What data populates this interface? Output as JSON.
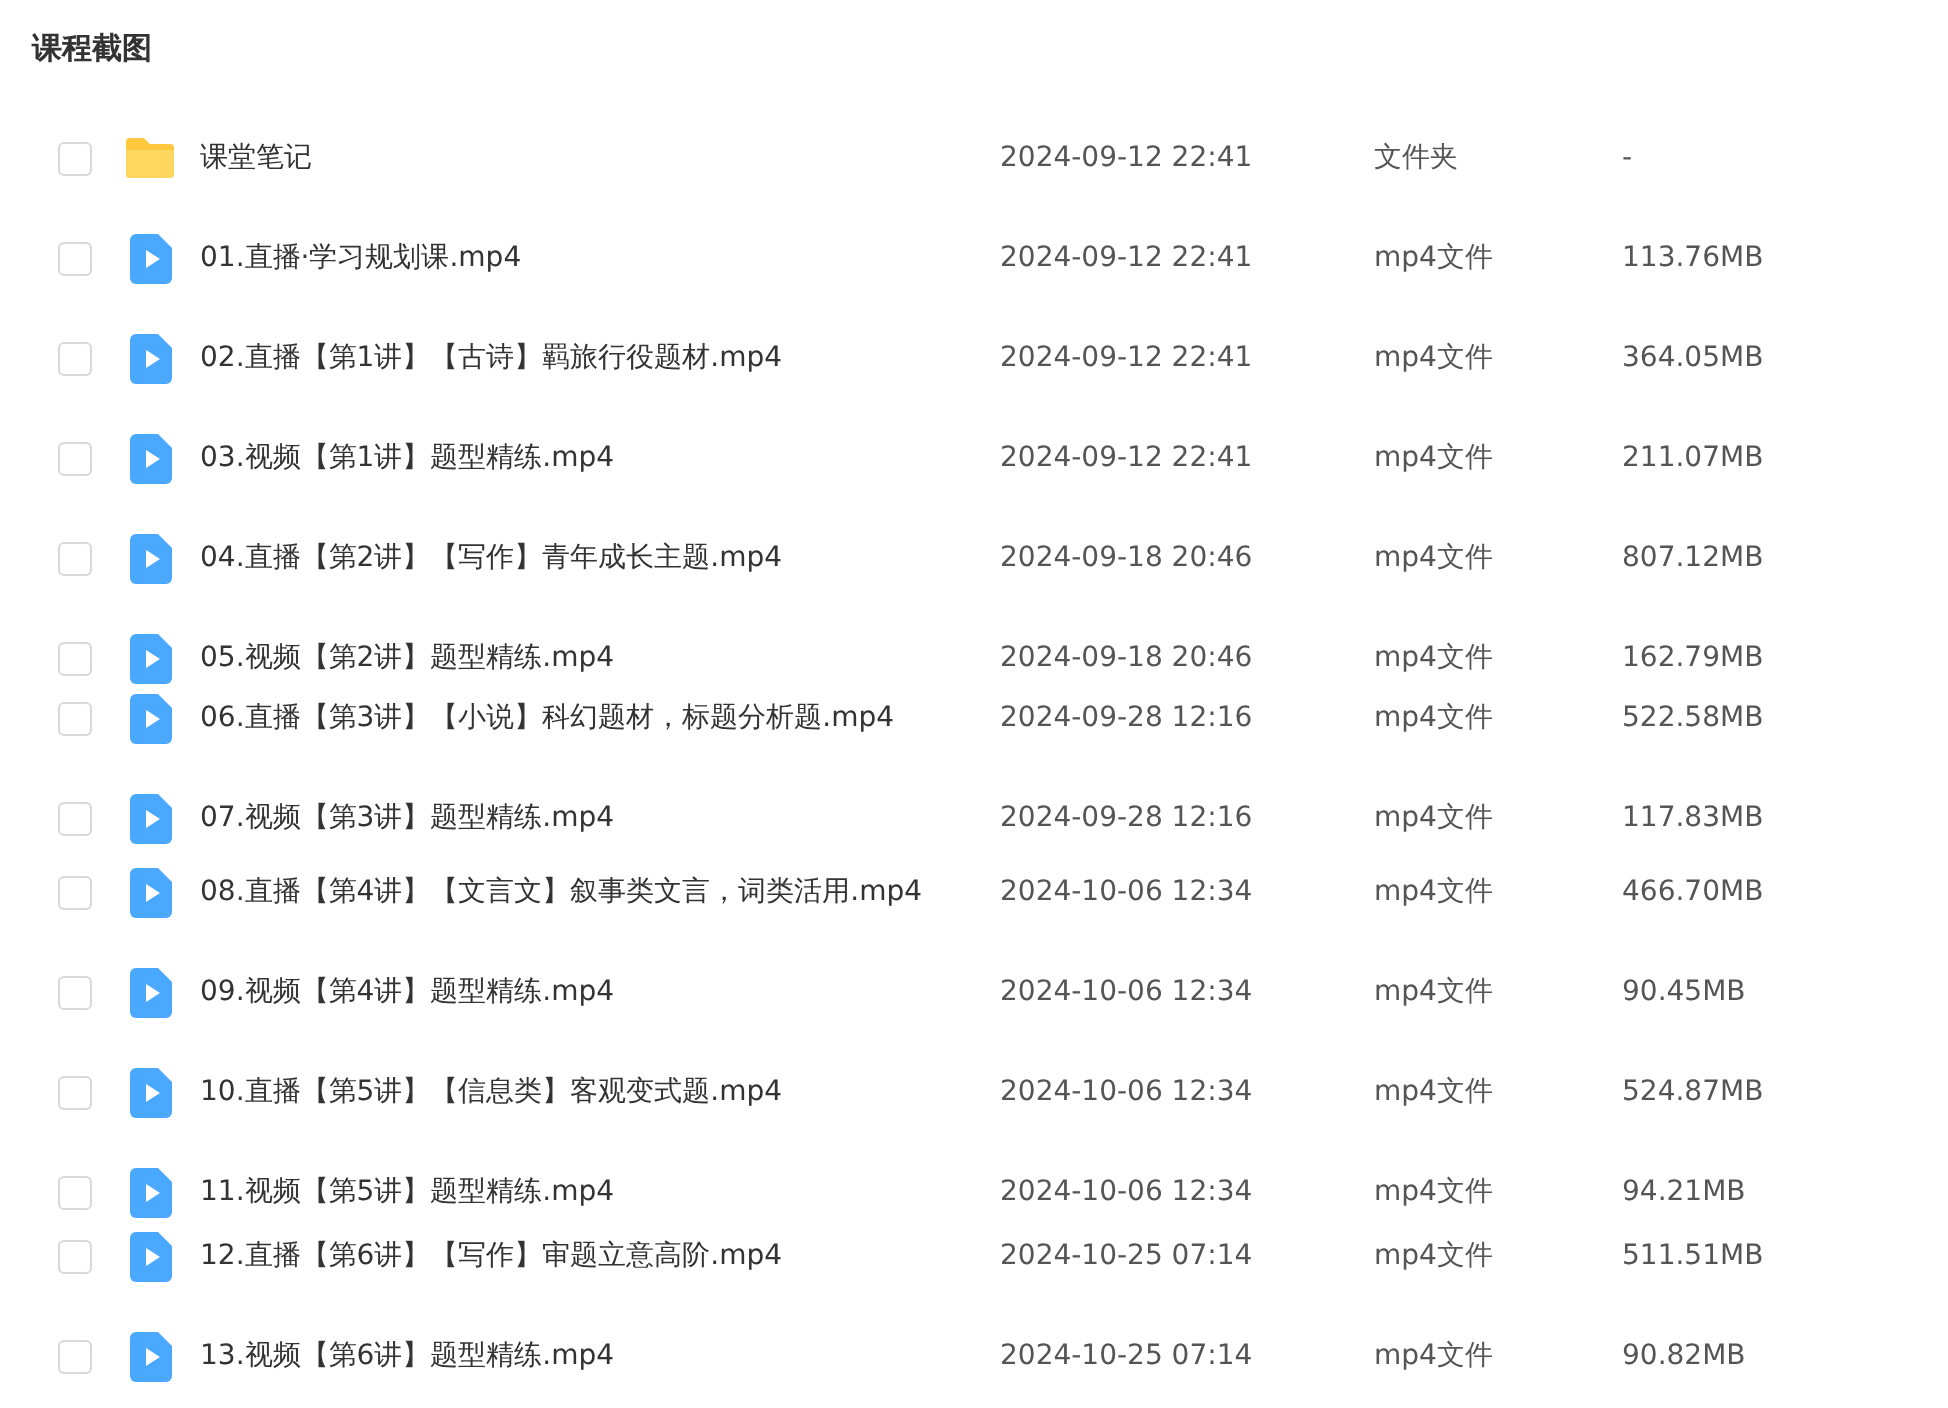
{
  "title": "课程截图",
  "files": [
    {
      "kind": "folder",
      "name": "课堂笔记",
      "date": "2024-09-12 22:41",
      "type": "文件夹",
      "size": "-",
      "checked": false
    },
    {
      "kind": "video",
      "name": "01.直播·学习规划课.mp4",
      "date": "2024-09-12 22:41",
      "type": "mp4文件",
      "size": "113.76MB",
      "checked": false
    },
    {
      "kind": "video",
      "name": "02.直播【第1讲】【古诗】羁旅行役题材.mp4",
      "date": "2024-09-12 22:41",
      "type": "mp4文件",
      "size": "364.05MB",
      "checked": false
    },
    {
      "kind": "video",
      "name": "03.视频【第1讲】题型精练.mp4",
      "date": "2024-09-12 22:41",
      "type": "mp4文件",
      "size": "211.07MB",
      "checked": false
    },
    {
      "kind": "video",
      "name": "04.直播【第2讲】【写作】青年成长主题.mp4",
      "date": "2024-09-18 20:46",
      "type": "mp4文件",
      "size": "807.12MB",
      "checked": false
    },
    {
      "kind": "video",
      "name": "05.视频【第2讲】题型精练.mp4",
      "date": "2024-09-18 20:46",
      "type": "mp4文件",
      "size": "162.79MB",
      "checked": false
    },
    {
      "kind": "video",
      "name": "06.直播【第3讲】【小说】科幻题材，标题分析题.mp4",
      "date": "2024-09-28 12:16",
      "type": "mp4文件",
      "size": "522.58MB",
      "checked": false
    },
    {
      "kind": "video",
      "name": "07.视频【第3讲】题型精练.mp4",
      "date": "2024-09-28 12:16",
      "type": "mp4文件",
      "size": "117.83MB",
      "checked": false
    },
    {
      "kind": "video",
      "name": "08.直播【第4讲】【文言文】叙事类文言，词类活用.mp4",
      "date": "2024-10-06 12:34",
      "type": "mp4文件",
      "size": "466.70MB",
      "checked": false
    },
    {
      "kind": "video",
      "name": "09.视频【第4讲】题型精练.mp4",
      "date": "2024-10-06 12:34",
      "type": "mp4文件",
      "size": "90.45MB",
      "checked": false
    },
    {
      "kind": "video",
      "name": "10.直播【第5讲】【信息类】客观变式题.mp4",
      "date": "2024-10-06 12:34",
      "type": "mp4文件",
      "size": "524.87MB",
      "checked": false
    },
    {
      "kind": "video",
      "name": "11.视频【第5讲】题型精练.mp4",
      "date": "2024-10-06 12:34",
      "type": "mp4文件",
      "size": "94.21MB",
      "checked": false
    },
    {
      "kind": "video",
      "name": "12.直播【第6讲】【写作】审题立意高阶.mp4",
      "date": "2024-10-25 07:14",
      "type": "mp4文件",
      "size": "511.51MB",
      "checked": false
    },
    {
      "kind": "video",
      "name": "13.视频【第6讲】题型精练.mp4",
      "date": "2024-10-25 07:14",
      "type": "mp4文件",
      "size": "90.82MB",
      "checked": false
    }
  ]
}
